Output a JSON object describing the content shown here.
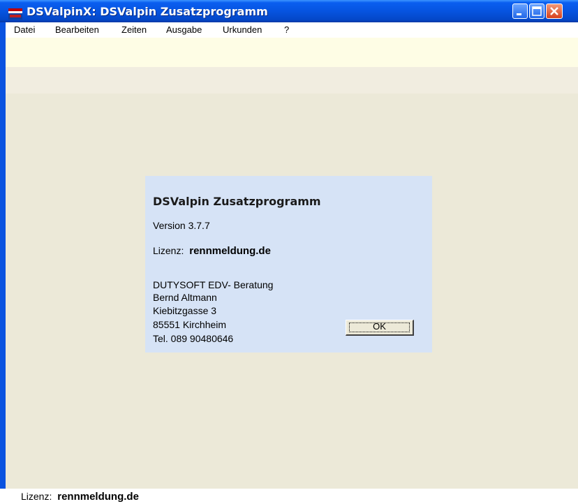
{
  "window": {
    "title": "DSValpinX: DSValpin Zusatzprogramm",
    "icon": "app-logo-icon"
  },
  "menu": {
    "items": [
      "Datei",
      "Bearbeiten",
      "Zeiten",
      "Ausgabe",
      "Urkunden",
      "?"
    ]
  },
  "about": {
    "app_name": "DSValpin Zusatzprogramm",
    "version": "Version 3.7.7",
    "license_label": "Lizenz:",
    "license_value": "rennmeldung.de",
    "address": [
      "DUTYSOFT EDV- Beratung",
      "Bernd Altmann",
      "Kiebitzgasse 3",
      "85551 Kirchheim",
      "Tel. 089 90480646"
    ],
    "ok_label": "OK"
  },
  "statusbar": {
    "license_label": "Lizenz:",
    "license_value": "rennmeldung.de"
  },
  "colors": {
    "titlebar": "#0654e0",
    "client_bg": "#ece9d8",
    "about_bg": "#d6e3f6",
    "close_button": "#d6411e"
  }
}
